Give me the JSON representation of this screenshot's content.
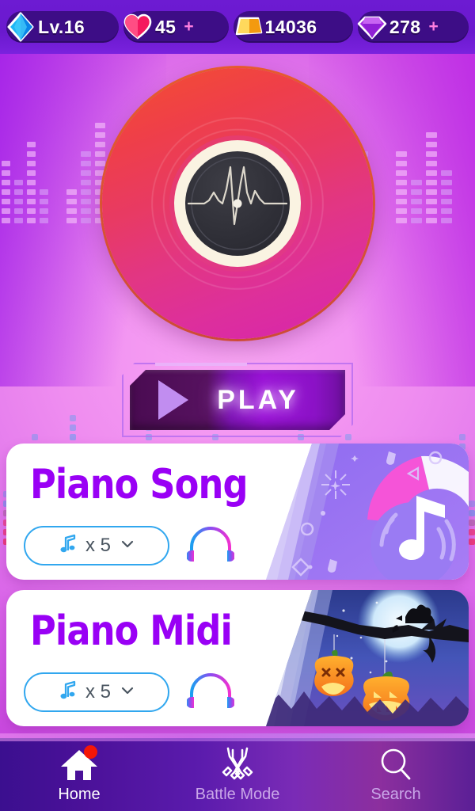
{
  "hud": {
    "level": {
      "icon": "blue-diamond-icon",
      "value": "Lv.16"
    },
    "hearts": {
      "icon": "heart-icon",
      "value": "45",
      "plus": "+"
    },
    "gold": {
      "icon": "gold-bar-icon",
      "value": "14036"
    },
    "gems": {
      "icon": "purple-gem-icon",
      "value": "278",
      "plus": "+"
    }
  },
  "hero": {
    "disc_icon": "vinyl-record-icon",
    "waveform_icon": "waveform-icon",
    "play_label": "PLAY",
    "play_icon": "play-triangle-icon"
  },
  "songs": [
    {
      "title": "Piano Song",
      "count_label": "x 5",
      "note_icon": "music-note-icon",
      "chevron_icon": "chevron-down-icon",
      "eq_icon": "headphone-equalizer-icon",
      "art": "music-note-artwork"
    },
    {
      "title": "Piano Midi",
      "count_label": "x 5",
      "note_icon": "music-note-icon",
      "chevron_icon": "chevron-down-icon",
      "eq_icon": "headphone-equalizer-icon",
      "art": "halloween-pumpkin-artwork"
    }
  ],
  "nav": [
    {
      "label": "Home",
      "icon": "home-icon",
      "active": true,
      "badge": true
    },
    {
      "label": "Battle Mode",
      "icon": "crossed-swords-icon",
      "active": false,
      "badge": false
    },
    {
      "label": "Search",
      "icon": "search-icon",
      "active": false,
      "badge": false
    }
  ],
  "colors": {
    "header_purple": "#6a19ce",
    "chip_purple": "#3d0d86",
    "title_purple": "#9900f5",
    "pill_blue": "#31a7ef",
    "badge_red": "#f51607",
    "heart_pink": "#f5185e",
    "gold_yellow": "#f9b421",
    "play_magenta": "#9913d6"
  }
}
